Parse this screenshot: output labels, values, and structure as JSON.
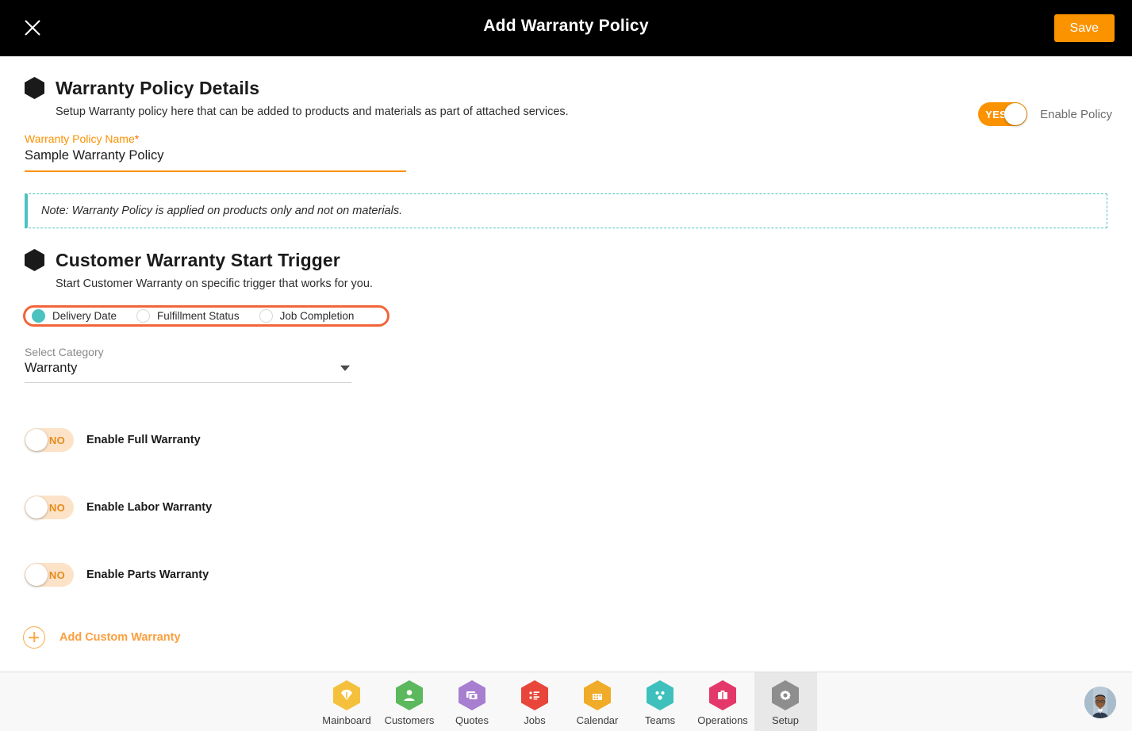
{
  "topbar": {
    "close_icon": "close-icon",
    "title": "Add Warranty Policy",
    "save_label": "Save",
    "bg": "#000000",
    "accent": "#fb9200"
  },
  "policy_details": {
    "heading": "Warranty Policy Details",
    "subtitle": "Setup Warranty policy here that can be added to products and materials as part of attached services.",
    "enable_policy": {
      "toggle_value": "YES",
      "label": "Enable Policy",
      "on": true,
      "on_color": "#fb9200"
    },
    "name_field": {
      "label": "Warranty Policy Name",
      "required_marker": "*",
      "value": "Sample Warranty Policy",
      "placeholder": "Warranty Policy Name",
      "underline_color": "#fb9200"
    }
  },
  "note": {
    "text": "Note: Warranty Policy is applied on products only and not on materials.",
    "accent": "#4cc2c0"
  },
  "trigger": {
    "heading": "Customer Warranty Start Trigger",
    "subtitle": "Start Customer Warranty on specific trigger that works for you.",
    "highlight_color": "#f2653a",
    "options": [
      {
        "label": "Delivery Date",
        "selected": true
      },
      {
        "label": "Fulfillment Status",
        "selected": false
      },
      {
        "label": "Job Completion",
        "selected": false
      }
    ]
  },
  "category": {
    "label": "Select Category",
    "value": "Warranty",
    "caret_icon": "chevron-down-icon"
  },
  "warranty_toggles": [
    {
      "toggle_value": "NO",
      "label": "Enable Full Warranty",
      "on": false
    },
    {
      "toggle_value": "NO",
      "label": "Enable Labor Warranty",
      "on": false
    },
    {
      "toggle_value": "NO",
      "label": "Enable Parts Warranty",
      "on": false
    }
  ],
  "add_custom": {
    "icon": "plus-circle-icon",
    "label": "Add Custom Warranty",
    "color": "#fb9f3e"
  },
  "footer_nav": {
    "items": [
      {
        "label": "Mainboard",
        "icon": "mainboard-icon",
        "color": "#f5c13d",
        "active": false
      },
      {
        "label": "Customers",
        "icon": "customers-icon",
        "color": "#5cb85c",
        "active": false
      },
      {
        "label": "Quotes",
        "icon": "quotes-icon",
        "color": "#a87fd0",
        "active": false
      },
      {
        "label": "Jobs",
        "icon": "jobs-icon",
        "color": "#e8463a",
        "active": false
      },
      {
        "label": "Calendar",
        "icon": "calendar-icon",
        "color": "#f0ab28",
        "active": false
      },
      {
        "label": "Teams",
        "icon": "teams-icon",
        "color": "#3fc0bd",
        "active": false
      },
      {
        "label": "Operations",
        "icon": "operations-icon",
        "color": "#e5386a",
        "active": false
      },
      {
        "label": "Setup",
        "icon": "gear-icon",
        "color": "#8e8e8e",
        "active": true
      }
    ],
    "avatar": "user-avatar"
  }
}
